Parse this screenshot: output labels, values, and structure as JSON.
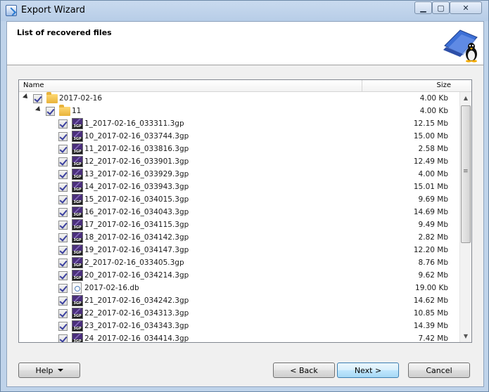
{
  "window": {
    "title": "Export Wizard",
    "min_glyph": "▁",
    "max_glyph": "▢",
    "close_glyph": "✕"
  },
  "header": {
    "title": "List of recovered files"
  },
  "list": {
    "columns": {
      "name": "Name",
      "size": "Size"
    },
    "rows": [
      {
        "level": 0,
        "type": "folder",
        "expander": true,
        "checked": true,
        "name": "2017-02-16",
        "size": "4.00 Kb"
      },
      {
        "level": 1,
        "type": "folder",
        "expander": true,
        "checked": true,
        "name": "11",
        "size": "4.00 Kb"
      },
      {
        "level": 2,
        "type": "3gp",
        "checked": true,
        "name": "1_2017-02-16_033311.3gp",
        "size": "12.15 Mb"
      },
      {
        "level": 2,
        "type": "3gp",
        "checked": true,
        "name": "10_2017-02-16_033744.3gp",
        "size": "15.00 Mb"
      },
      {
        "level": 2,
        "type": "3gp",
        "checked": true,
        "name": "11_2017-02-16_033816.3gp",
        "size": "2.58 Mb"
      },
      {
        "level": 2,
        "type": "3gp",
        "checked": true,
        "name": "12_2017-02-16_033901.3gp",
        "size": "12.49 Mb"
      },
      {
        "level": 2,
        "type": "3gp",
        "checked": true,
        "name": "13_2017-02-16_033929.3gp",
        "size": "4.00 Mb"
      },
      {
        "level": 2,
        "type": "3gp",
        "checked": true,
        "name": "14_2017-02-16_033943.3gp",
        "size": "15.01 Mb"
      },
      {
        "level": 2,
        "type": "3gp",
        "checked": true,
        "name": "15_2017-02-16_034015.3gp",
        "size": "9.69 Mb"
      },
      {
        "level": 2,
        "type": "3gp",
        "checked": true,
        "name": "16_2017-02-16_034043.3gp",
        "size": "14.69 Mb"
      },
      {
        "level": 2,
        "type": "3gp",
        "checked": true,
        "name": "17_2017-02-16_034115.3gp",
        "size": "9.49 Mb"
      },
      {
        "level": 2,
        "type": "3gp",
        "checked": true,
        "name": "18_2017-02-16_034142.3gp",
        "size": "2.82 Mb"
      },
      {
        "level": 2,
        "type": "3gp",
        "checked": true,
        "name": "19_2017-02-16_034147.3gp",
        "size": "12.20 Mb"
      },
      {
        "level": 2,
        "type": "3gp",
        "checked": true,
        "name": "2_2017-02-16_033405.3gp",
        "size": "8.76 Mb"
      },
      {
        "level": 2,
        "type": "3gp",
        "checked": true,
        "name": "20_2017-02-16_034214.3gp",
        "size": "9.62 Mb"
      },
      {
        "level": 2,
        "type": "db",
        "checked": true,
        "name": "2017-02-16.db",
        "size": "19.00 Kb"
      },
      {
        "level": 2,
        "type": "3gp",
        "checked": true,
        "name": "21_2017-02-16_034242.3gp",
        "size": "14.62 Mb"
      },
      {
        "level": 2,
        "type": "3gp",
        "checked": true,
        "name": "22_2017-02-16_034313.3gp",
        "size": "10.85 Mb"
      },
      {
        "level": 2,
        "type": "3gp",
        "checked": true,
        "name": "23_2017-02-16_034343.3gp",
        "size": "14.39 Mb"
      },
      {
        "level": 2,
        "type": "3gp",
        "checked": true,
        "name": "24_2017-02-16_034414.3gp",
        "size": "7.42 Mb"
      }
    ],
    "icon_3gp_label": "3GP"
  },
  "scrollbar": {
    "up_glyph": "▲",
    "down_glyph": "▼"
  },
  "buttons": {
    "help": "Help",
    "back": "< Back",
    "next": "Next >",
    "cancel": "Cancel"
  }
}
